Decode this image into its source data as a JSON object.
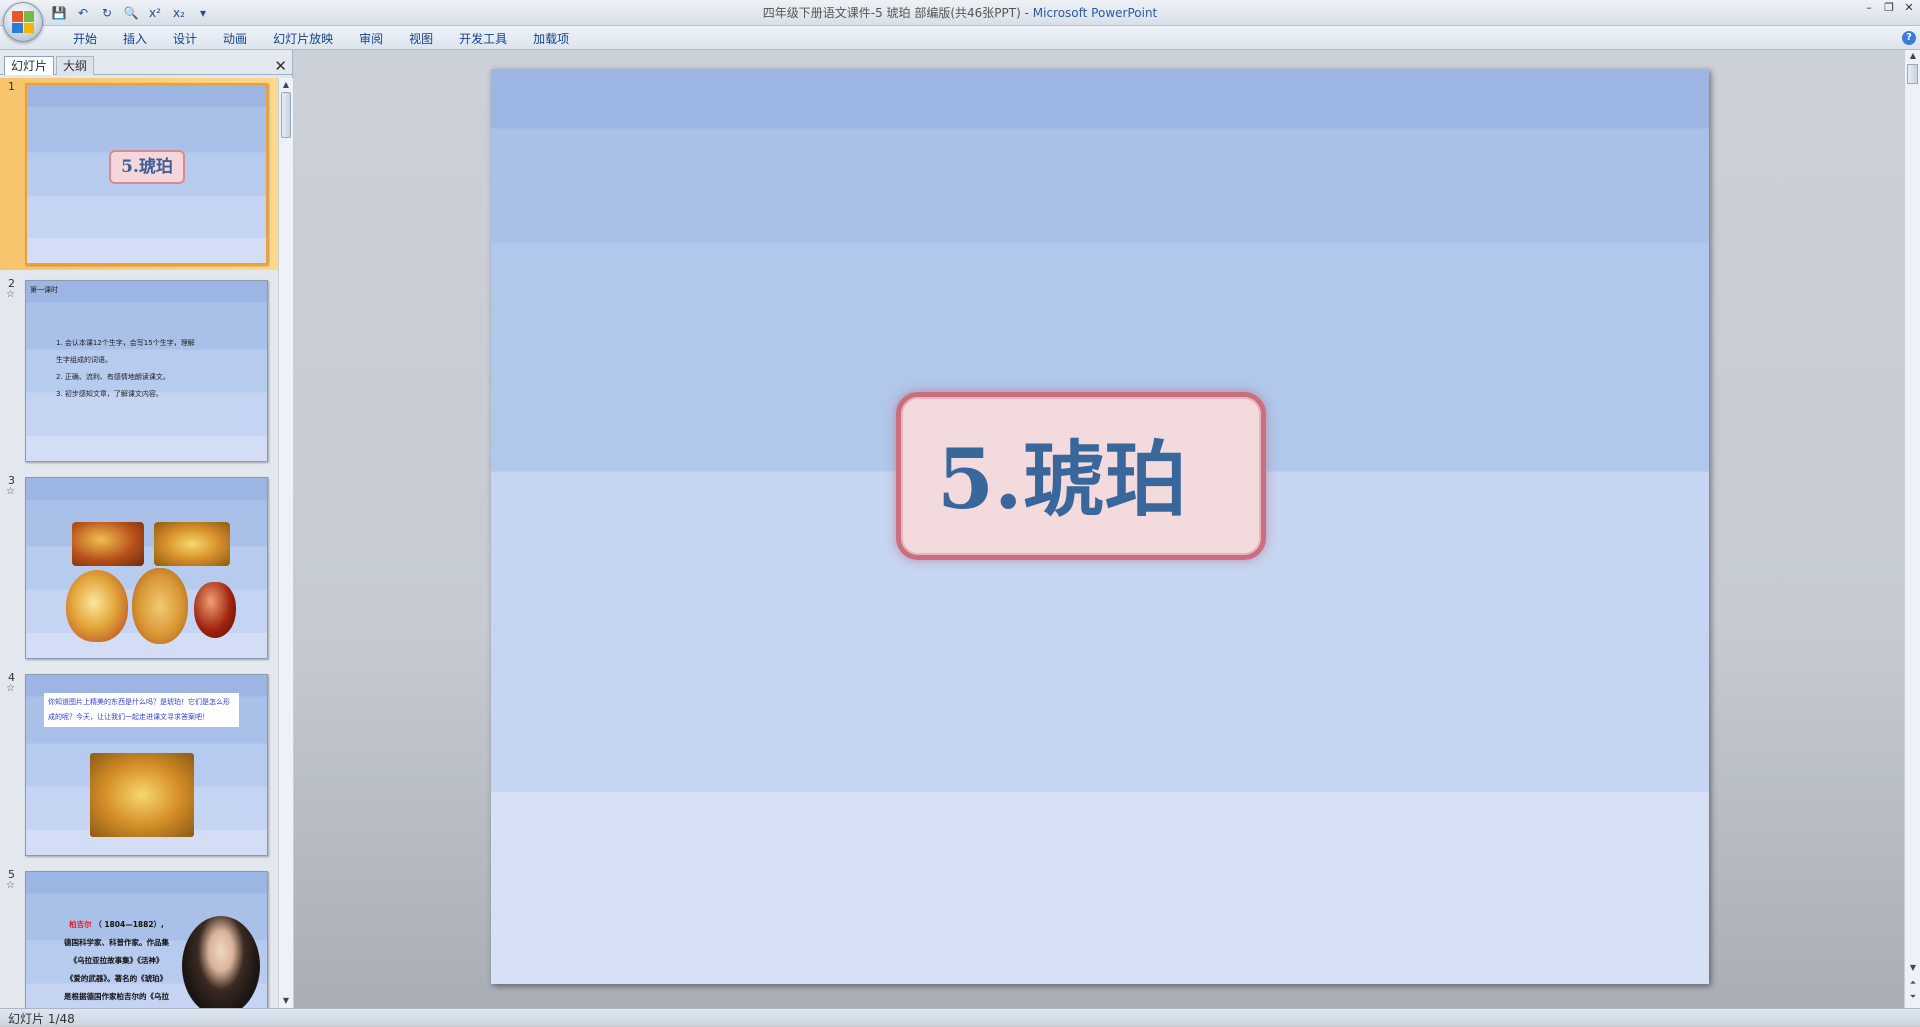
{
  "window": {
    "title_doc": "四年级下册语文课件-5 琥珀 部编版(共46张PPT)",
    "title_sep": " - ",
    "title_app": "Microsoft PowerPoint"
  },
  "ribbon": {
    "tabs": [
      "开始",
      "插入",
      "设计",
      "动画",
      "幻灯片放映",
      "审阅",
      "视图",
      "开发工具",
      "加载项"
    ]
  },
  "panel": {
    "tab_slides": "幻灯片",
    "tab_outline": "大纲"
  },
  "thumbnails": [
    {
      "num": "1",
      "title": "5.琥珀",
      "selected": true
    },
    {
      "num": "2",
      "header": "第一课时",
      "items": [
        "1. 会认本课12个生字，会写15个生字，理解",
        "   生字组成的词语。",
        "2. 正确、流利、有感情地朗读课文。",
        "3. 初步感知文章，了解课文内容。"
      ]
    },
    {
      "num": "3"
    },
    {
      "num": "4",
      "text": "你知道图片上精美的东西是什么吗？是琥珀！它们是怎么形成的呢？今天，让让我们一起走进课文寻求答案吧！"
    },
    {
      "num": "5",
      "name": "柏吉尔",
      "years": "（ 1804—1882）,",
      "lines": [
        "德国科学家、科普作家。作品集",
        "《乌拉亚拉故事集》《活神》",
        "《爱的武器》。著名的《琥珀》",
        "是根据德国作家柏吉尔的《乌拉"
      ]
    }
  ],
  "slide": {
    "title": "5.琥珀"
  },
  "status": {
    "slide_indicator": "幻灯片 1/48"
  }
}
